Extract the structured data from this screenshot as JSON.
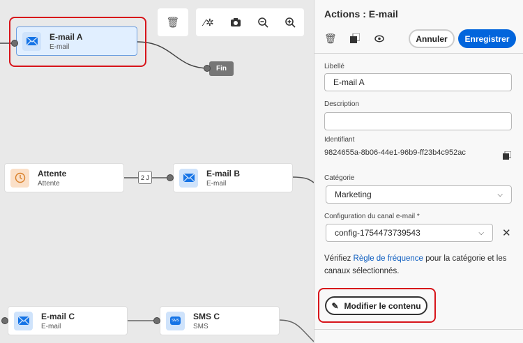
{
  "canvas": {
    "toolbar": {
      "delete": "trash-icon",
      "tools": [
        "magic-wand-icon",
        "camera-icon",
        "zoom-out-icon",
        "zoom-in-icon"
      ]
    },
    "nodes": [
      {
        "title": "E-mail A",
        "subtitle": "E-mail"
      },
      {
        "title": "Attente",
        "subtitle": "Attente"
      },
      {
        "title": "E-mail B",
        "subtitle": "E-mail"
      },
      {
        "title": "E-mail C",
        "subtitle": "E-mail"
      },
      {
        "title": "SMS C",
        "subtitle": "SMS"
      }
    ],
    "end_label": "Fin",
    "wait_badge": "2 J",
    "sms_glyph": "SMS"
  },
  "panel": {
    "title": "Actions : E-mail",
    "cancel": "Annuler",
    "save": "Enregistrer",
    "label_field": {
      "label": "Libellé",
      "value": "E-mail A"
    },
    "description_field": {
      "label": "Description",
      "value": ""
    },
    "identifier": {
      "label": "Identifiant",
      "value": "9824655a-8b06-44e1-96b9-ff23b4c952ac"
    },
    "category": {
      "label": "Catégorie",
      "value": "Marketing"
    },
    "channel_config": {
      "label": "Configuration du canal e-mail",
      "required": "*",
      "value": "config-1754473739543"
    },
    "info": {
      "before": "Vérifiez ",
      "link": "Règle de fréquence",
      "after": " pour la catégorie et les canaux sélectionnés."
    },
    "edit_content": "Modifier le contenu"
  },
  "colors": {
    "accent": "#0265dc",
    "highlight": "#d7141a"
  }
}
